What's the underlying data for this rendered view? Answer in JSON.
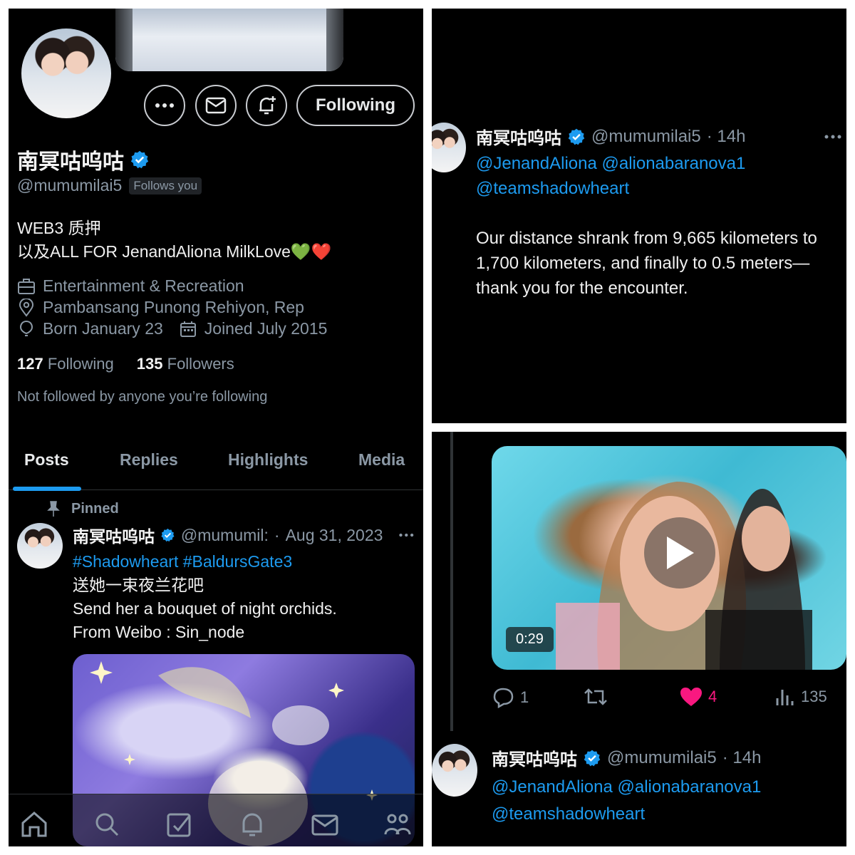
{
  "profile": {
    "display_name": "南冥咕呜咕",
    "handle": "@mumumilai5",
    "follows_you": "Follows you",
    "follow_button": "Following",
    "bio_line1": "WEB3 质押",
    "bio_line2": "以及ALL FOR JenandAliona MilkLove💚❤️",
    "category": "Entertainment & Recreation",
    "location": "Pambansang Punong Rehiyon, Rep",
    "birthday": "Born January 23",
    "joined": "Joined July 2015",
    "following_count": "127",
    "following_label": "Following",
    "followers_count": "135",
    "followers_label": "Followers",
    "not_followed": "Not followed by anyone you’re following"
  },
  "tabs": [
    {
      "label": "Posts",
      "active": true
    },
    {
      "label": "Replies"
    },
    {
      "label": "Highlights"
    },
    {
      "label": "Media"
    }
  ],
  "pinned_post": {
    "pinned_label": "Pinned",
    "name": "南冥咕呜咕",
    "handle": "@mumumil:",
    "dot": "·",
    "date": "Aug 31, 2023",
    "hashtags": "#Shadowheart  #BaldursGate3",
    "line1": "送她一束夜兰花吧",
    "line2": "Send her a bouquet of night orchids.",
    "line3": "From Weibo : Sin_node"
  },
  "post2": {
    "name": "南冥咕呜咕",
    "handle": "@mumumilai5",
    "time": "· 14h",
    "mention_line1": "@JenandAliona  @alionabaranova1",
    "mention_line2": "@teamshadowheart",
    "text": "Our distance shrank from 9,665 kilometers to 1,700 kilometers, and finally to 0.5 meters—thank you for the encounter."
  },
  "video_post": {
    "duration": "0:29",
    "replies": "1",
    "likes": "4",
    "views": "135"
  },
  "post3": {
    "name": "南冥咕呜咕",
    "handle": "@mumumilai5",
    "time": "· 14h",
    "mention_line1": "@JenandAliona  @alionabaranova1",
    "mention_line2": "@teamshadowheart"
  },
  "colors": {
    "accent": "#1d9bf0",
    "background": "#000000",
    "like": "#f91880",
    "muted": "#8b98a5"
  },
  "icons": [
    "more-icon",
    "mail-icon",
    "bell-plus-icon",
    "verified-icon",
    "briefcase-icon",
    "location-icon",
    "balloon-icon",
    "calendar-icon",
    "pin-icon",
    "home-icon",
    "search-icon",
    "grok-icon",
    "notifications-icon",
    "messages-icon",
    "communities-icon",
    "reply-icon",
    "repost-icon",
    "heart-icon",
    "views-icon",
    "play-icon"
  ]
}
